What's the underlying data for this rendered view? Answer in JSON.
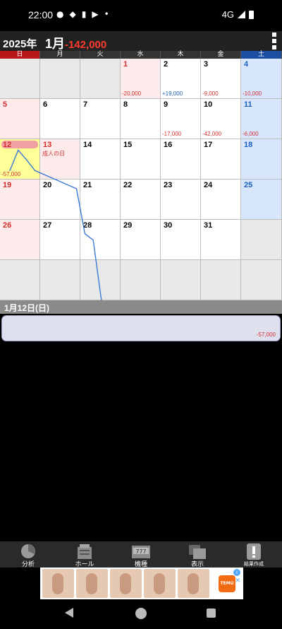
{
  "status": {
    "time": "22:00",
    "network": "4G"
  },
  "header": {
    "year": "2025年",
    "month": "1月",
    "total": "-142,000"
  },
  "weekdays": [
    "日",
    "月",
    "火",
    "水",
    "木",
    "金",
    "土"
  ],
  "calendar": {
    "rows": [
      [
        {
          "d": "",
          "t": "empty"
        },
        {
          "d": "",
          "t": "empty"
        },
        {
          "d": "",
          "t": "empty"
        },
        {
          "d": "1",
          "t": "holiday",
          "amt": "-20,000"
        },
        {
          "d": "2",
          "t": "normal",
          "amt": "+19,000"
        },
        {
          "d": "3",
          "t": "normal",
          "amt": "-9,000"
        },
        {
          "d": "4",
          "t": "sat",
          "amt": "-10,000"
        }
      ],
      [
        {
          "d": "5",
          "t": "sun"
        },
        {
          "d": "6",
          "t": "normal"
        },
        {
          "d": "7",
          "t": "normal"
        },
        {
          "d": "8",
          "t": "normal"
        },
        {
          "d": "9",
          "t": "normal",
          "amt": "-17,000"
        },
        {
          "d": "10",
          "t": "normal",
          "amt": "-42,000"
        },
        {
          "d": "11",
          "t": "sat",
          "amt": "-6,000"
        }
      ],
      [
        {
          "d": "12",
          "t": "sel",
          "amt": "-57,000"
        },
        {
          "d": "13",
          "t": "holiday",
          "holiday": "成人の日"
        },
        {
          "d": "14",
          "t": "normal"
        },
        {
          "d": "15",
          "t": "normal"
        },
        {
          "d": "16",
          "t": "normal"
        },
        {
          "d": "17",
          "t": "normal"
        },
        {
          "d": "18",
          "t": "sat"
        }
      ],
      [
        {
          "d": "19",
          "t": "sun"
        },
        {
          "d": "20",
          "t": "normal"
        },
        {
          "d": "21",
          "t": "normal"
        },
        {
          "d": "22",
          "t": "normal"
        },
        {
          "d": "23",
          "t": "normal"
        },
        {
          "d": "24",
          "t": "normal"
        },
        {
          "d": "25",
          "t": "sat"
        }
      ],
      [
        {
          "d": "26",
          "t": "sun"
        },
        {
          "d": "27",
          "t": "normal"
        },
        {
          "d": "28",
          "t": "normal"
        },
        {
          "d": "29",
          "t": "normal"
        },
        {
          "d": "30",
          "t": "normal"
        },
        {
          "d": "31",
          "t": "normal"
        },
        {
          "d": "",
          "t": "empty"
        }
      ],
      [
        {
          "d": "",
          "t": "empty"
        },
        {
          "d": "",
          "t": "empty"
        },
        {
          "d": "",
          "t": "empty"
        },
        {
          "d": "",
          "t": "empty"
        },
        {
          "d": "",
          "t": "empty"
        },
        {
          "d": "",
          "t": "empty"
        },
        {
          "d": "",
          "t": "empty"
        }
      ]
    ]
  },
  "chart_data": {
    "type": "line",
    "x": [
      1,
      2,
      3,
      4,
      9,
      10,
      11,
      12
    ],
    "y": [
      -20000,
      -1000,
      -10000,
      -20000,
      -37000,
      -79000,
      -85000,
      -142000
    ],
    "color": "#3a7bd5"
  },
  "detail": {
    "date": "1月12日(日)",
    "value": "-57,000"
  },
  "toolbar": {
    "items": [
      {
        "label": "分析",
        "icon": "pie-chart-icon"
      },
      {
        "label": "ホール",
        "icon": "building-icon"
      },
      {
        "label": "機種",
        "icon": "slot-machine-icon"
      },
      {
        "label": "表示",
        "icon": "display-icon"
      },
      {
        "label": "結果作成",
        "icon": "exclamation-icon"
      }
    ]
  },
  "ad": {
    "brand": "TEMU"
  }
}
